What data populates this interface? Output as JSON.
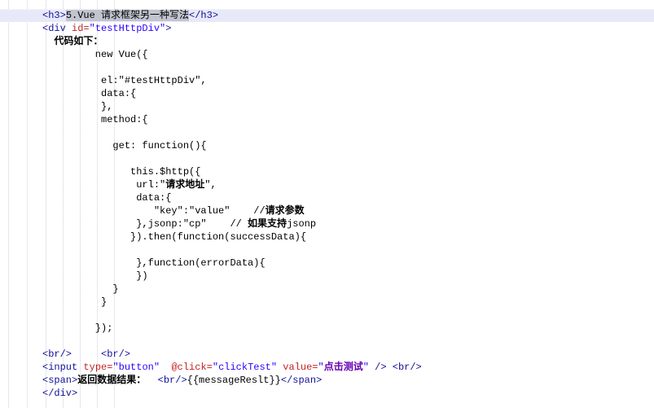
{
  "editor": {
    "type": "code-editor-viewport",
    "background": "#ffffff",
    "colors": {
      "tag": "#10109a",
      "attribute_name": "#c42222",
      "string_value": "#2a00ff",
      "plain_text": "#000000",
      "cjk_attribute_value": "#6600b2",
      "current_line_highlight": "#e8e9f8",
      "selection_background": "#c2c4cf",
      "indent_guide": "#cfcfdc"
    },
    "highlighted_line_index": 0,
    "selected_text": "5.Vue 请求框架另一种写法",
    "lines": [
      {
        "highlighted": true,
        "segments": [
          {
            "text": "<h3>",
            "style": "tag"
          },
          {
            "text": "5.Vue 请求框架另一种写法",
            "style": "text",
            "selected": true
          },
          {
            "text": "</h3>",
            "style": "tag"
          }
        ]
      },
      {
        "segments": [
          {
            "text": "<div ",
            "style": "tag"
          },
          {
            "text": "id=",
            "style": "attr"
          },
          {
            "text": "\"testHttpDiv\"",
            "style": "str"
          },
          {
            "text": ">",
            "style": "tag"
          }
        ]
      },
      {
        "segments": [
          {
            "text": "  ",
            "style": "text"
          },
          {
            "text": "代码如下：",
            "style": "cjk"
          }
        ]
      },
      {
        "segments": [
          {
            "text": "         new Vue({",
            "style": "text"
          }
        ]
      },
      {
        "segments": []
      },
      {
        "segments": [
          {
            "text": "          el:\"#testHttpDiv\",",
            "style": "text"
          }
        ]
      },
      {
        "segments": [
          {
            "text": "          data:{",
            "style": "text"
          }
        ]
      },
      {
        "segments": [
          {
            "text": "          },",
            "style": "text"
          }
        ]
      },
      {
        "segments": [
          {
            "text": "          method:{",
            "style": "text"
          }
        ]
      },
      {
        "segments": []
      },
      {
        "segments": [
          {
            "text": "            get: function(){",
            "style": "text"
          }
        ]
      },
      {
        "segments": []
      },
      {
        "segments": [
          {
            "text": "               this.$http({",
            "style": "text"
          }
        ]
      },
      {
        "segments": [
          {
            "text": "                url:\"",
            "style": "text"
          },
          {
            "text": "请求地址",
            "style": "cjk"
          },
          {
            "text": "\",",
            "style": "text"
          }
        ]
      },
      {
        "segments": [
          {
            "text": "                data:{",
            "style": "text"
          }
        ]
      },
      {
        "segments": [
          {
            "text": "                   \"key\":\"value\"    //",
            "style": "text"
          },
          {
            "text": "请求参数",
            "style": "cjk"
          }
        ]
      },
      {
        "segments": [
          {
            "text": "                },jsonp:\"cp\"    // ",
            "style": "text"
          },
          {
            "text": "如果支持",
            "style": "cjk"
          },
          {
            "text": "jsonp",
            "style": "text"
          }
        ]
      },
      {
        "segments": [
          {
            "text": "               }).then(function(successData){",
            "style": "text"
          }
        ]
      },
      {
        "segments": []
      },
      {
        "segments": [
          {
            "text": "                },function(errorData){",
            "style": "text"
          }
        ]
      },
      {
        "segments": [
          {
            "text": "                })",
            "style": "text"
          }
        ]
      },
      {
        "segments": [
          {
            "text": "            }",
            "style": "text"
          }
        ]
      },
      {
        "segments": [
          {
            "text": "          }",
            "style": "text"
          }
        ]
      },
      {
        "segments": []
      },
      {
        "segments": [
          {
            "text": "         });",
            "style": "text"
          }
        ]
      },
      {
        "segments": []
      },
      {
        "segments": [
          {
            "text": "<br/>",
            "style": "tag"
          },
          {
            "text": "     ",
            "style": "text"
          },
          {
            "text": "<br/>",
            "style": "tag"
          }
        ]
      },
      {
        "segments": [
          {
            "text": "<input ",
            "style": "tag"
          },
          {
            "text": "type=",
            "style": "attr"
          },
          {
            "text": "\"button\"",
            "style": "str"
          },
          {
            "text": "  ",
            "style": "text"
          },
          {
            "text": "@click=",
            "style": "attr"
          },
          {
            "text": "\"clickTest\"",
            "style": "str"
          },
          {
            "text": " ",
            "style": "text"
          },
          {
            "text": "value=",
            "style": "attr"
          },
          {
            "text": "\"",
            "style": "str"
          },
          {
            "text": "点击测试",
            "style": "cjkval"
          },
          {
            "text": "\"",
            "style": "str"
          },
          {
            "text": " ",
            "style": "text"
          },
          {
            "text": "/>",
            "style": "tag"
          },
          {
            "text": " ",
            "style": "text"
          },
          {
            "text": "<br/>",
            "style": "tag"
          }
        ]
      },
      {
        "segments": [
          {
            "text": "<span>",
            "style": "tag"
          },
          {
            "text": "返回数据结果：",
            "style": "cjk"
          },
          {
            "text": "  ",
            "style": "text"
          },
          {
            "text": "<br/>",
            "style": "tag"
          },
          {
            "text": "{{messageReslt}}",
            "style": "text"
          },
          {
            "text": "</span>",
            "style": "tag"
          }
        ]
      },
      {
        "segments": [
          {
            "text": "</div>",
            "style": "tag"
          }
        ]
      }
    ]
  }
}
